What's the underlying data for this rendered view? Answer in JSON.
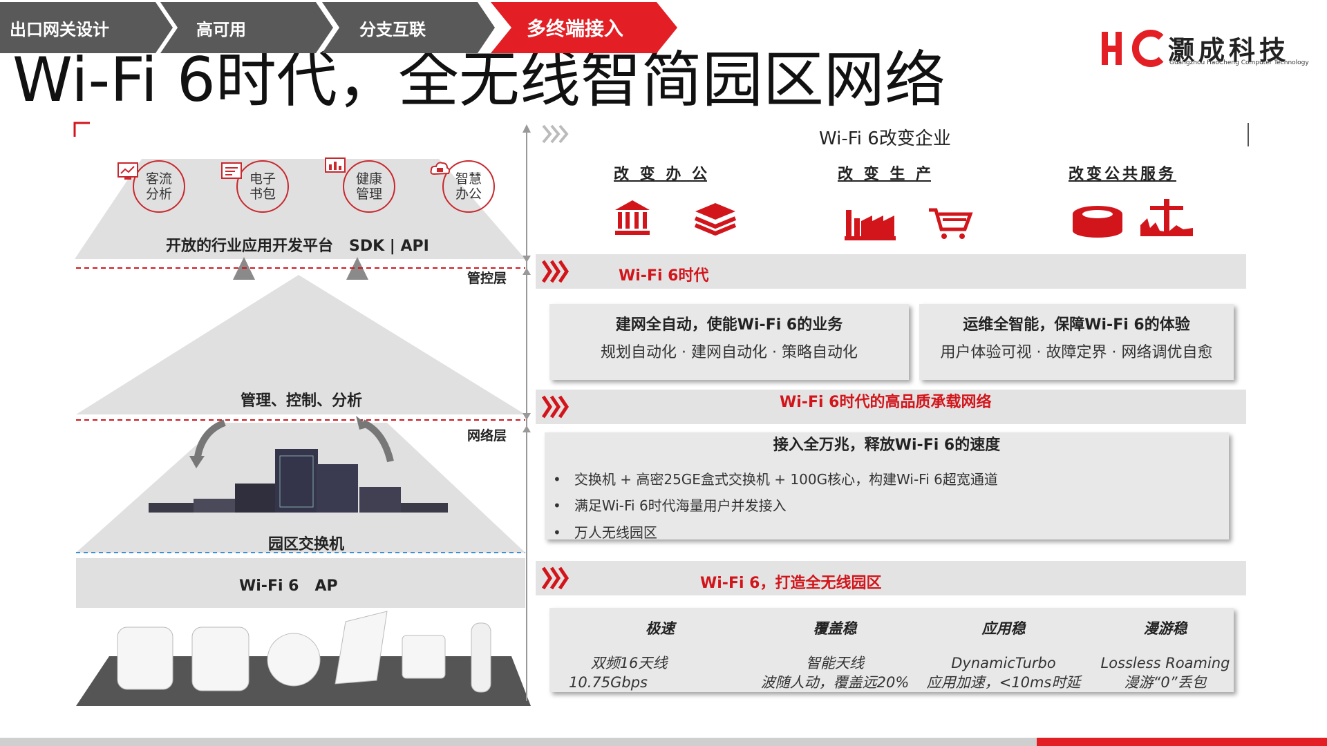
{
  "breadcrumb": [
    {
      "label": "出口网关设计",
      "active": false
    },
    {
      "label": "高可用",
      "active": false
    },
    {
      "label": "分支互联",
      "active": false
    },
    {
      "label": "多终端接入",
      "active": true
    }
  ],
  "title": "Wi-Fi 6时代，全无线智简园区网络",
  "logo": {
    "mark": "HC",
    "name": "灏成科技",
    "sub": "Guangzhou HaoCheng Computer Technology"
  },
  "colors": {
    "accent": "#d2151b",
    "crumb_gray": "#595959",
    "band_gray": "#e3e3e3"
  },
  "left": {
    "apps": [
      {
        "label_1": "客流",
        "label_2": "分析",
        "icon": "monitor-chart-icon"
      },
      {
        "label_1": "电子",
        "label_2": "书包",
        "icon": "ebook-icon"
      },
      {
        "label_1": "健康",
        "label_2": "管理",
        "icon": "health-chart-icon"
      },
      {
        "label_1": "智慧",
        "label_2": "办公",
        "icon": "office-cloud-icon"
      }
    ],
    "platform": "开放的行业应用开发平台   SDK | API",
    "control_layer": "管控层",
    "mgmt": "管理、控制、分析",
    "network_layer": "网络层",
    "switch": "园区交换机",
    "ap": "Wi-Fi 6   AP"
  },
  "right": {
    "header": "Wi-Fi 6改变企业",
    "columns": [
      {
        "label": "改 变 办 公",
        "icons": [
          "bank-icon",
          "layers-icon"
        ]
      },
      {
        "label": "改 变 生 产",
        "icons": [
          "factory-icon",
          "cart-icon"
        ]
      },
      {
        "label": "改变公共服务",
        "icons": [
          "stadium-icon",
          "statue-icon"
        ]
      }
    ],
    "band1": "Wi-Fi 6时代",
    "card1": {
      "title": "建网全自动，使能Wi-Fi 6的业务",
      "sub": "规划自动化 · 建网自动化 · 策略自动化"
    },
    "card2": {
      "title": "运维全智能，保障Wi-Fi 6的体验",
      "sub": "用户体验可视 · 故障定界 · 网络调优自愈"
    },
    "band2": "Wi-Fi 6时代的高品质承载网络",
    "card3": {
      "title": "接入全万兆，释放Wi-Fi 6的速度",
      "bullets": [
        "交换机 + 高密25GE盒式交换机 + 100G核心，构建Wi-Fi 6超宽通道",
        "满足Wi-Fi 6时代海量用户并发接入",
        "万人无线园区"
      ]
    },
    "band3": "Wi-Fi 6，打造全无线园区",
    "features": [
      {
        "title": "极速",
        "line1": "双频16天线",
        "line2": "10.75Gbps"
      },
      {
        "title": "覆盖稳",
        "line1": "智能天线",
        "line2": "波随人动，覆盖远20%"
      },
      {
        "title": "应用稳",
        "line1": "DynamicTurbo",
        "line2": "应用加速，<10ms时延"
      },
      {
        "title": "漫游稳",
        "line1": "Lossless Roaming",
        "line2": "漫游“0”丢包"
      }
    ]
  }
}
